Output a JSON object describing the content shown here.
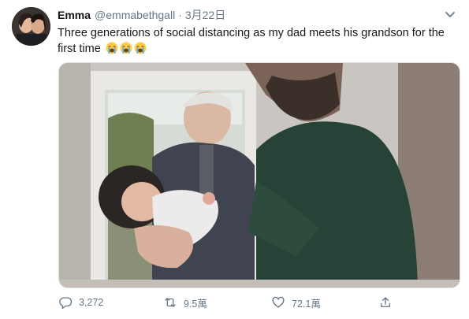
{
  "author": {
    "name": "Emma",
    "handle": "@emmabethgall",
    "separator": "·",
    "date": "3月22日"
  },
  "tweet": {
    "text": "Three generations of social distancing as my dad meets his grandson for the first time",
    "emoji": [
      "loudly-crying-face",
      "loudly-crying-face",
      "loudly-crying-face"
    ]
  },
  "actions": {
    "replies": "3,272",
    "retweets": "9.5萬",
    "likes": "72.1萬"
  },
  "icons": {
    "more": "chevron-down-icon",
    "reply": "reply-icon",
    "retweet": "retweet-icon",
    "like": "heart-icon",
    "share": "share-icon"
  },
  "colors": {
    "muted": "#657786",
    "text": "#14171a",
    "emoji": "#ffcc4d"
  }
}
